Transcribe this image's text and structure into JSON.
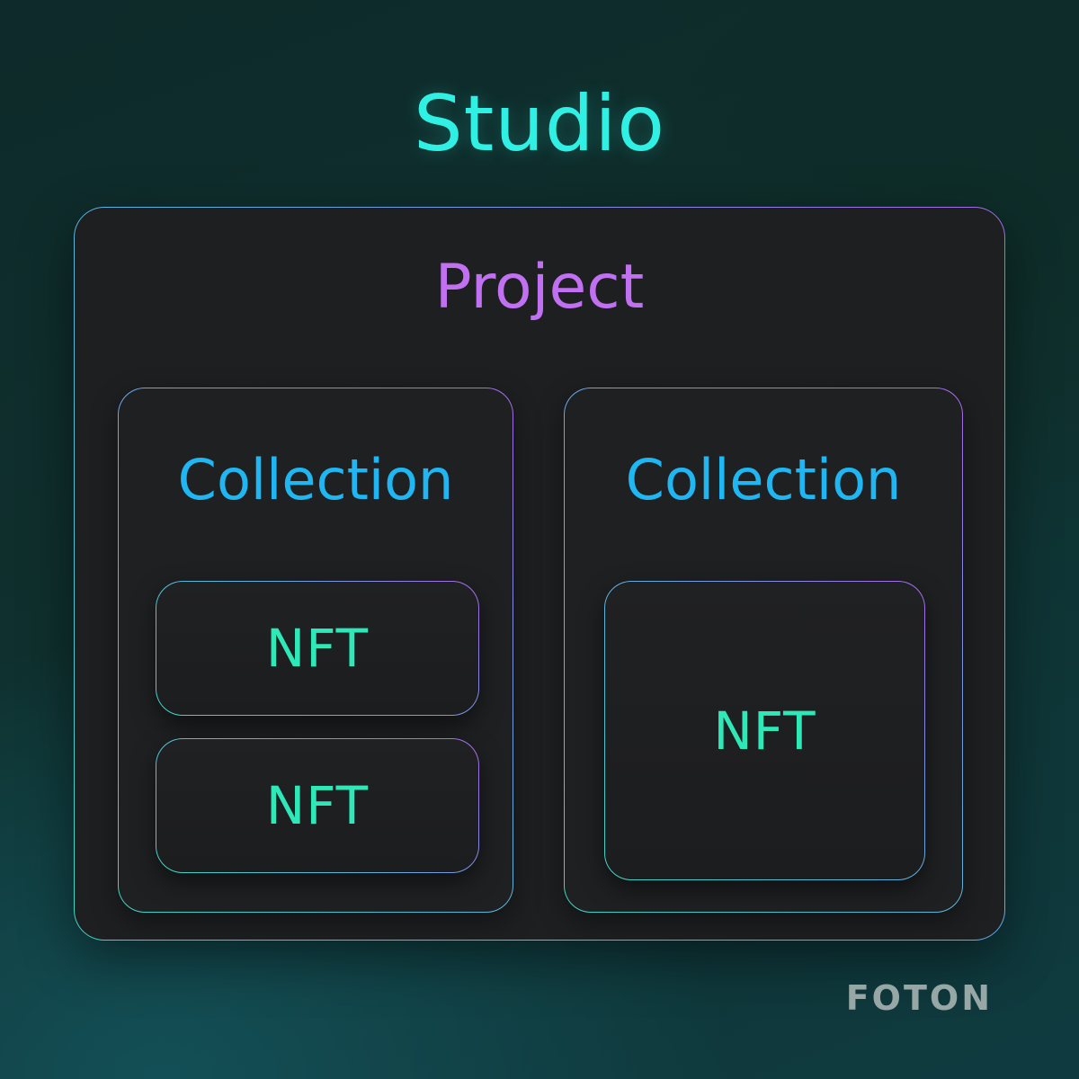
{
  "diagram": {
    "studio": {
      "label": "Studio"
    },
    "project": {
      "label": "Project"
    },
    "collections": [
      {
        "label": "Collection",
        "nfts": [
          {
            "label": "NFT"
          },
          {
            "label": "NFT"
          }
        ]
      },
      {
        "label": "Collection",
        "nfts": [
          {
            "label": "NFT"
          }
        ]
      }
    ]
  },
  "brand": {
    "name": "FOTON"
  },
  "colors": {
    "studio": "#2ff0e2",
    "project": "#c070f0",
    "collection": "#1fb6f2",
    "nft": "#2fe8b8"
  }
}
